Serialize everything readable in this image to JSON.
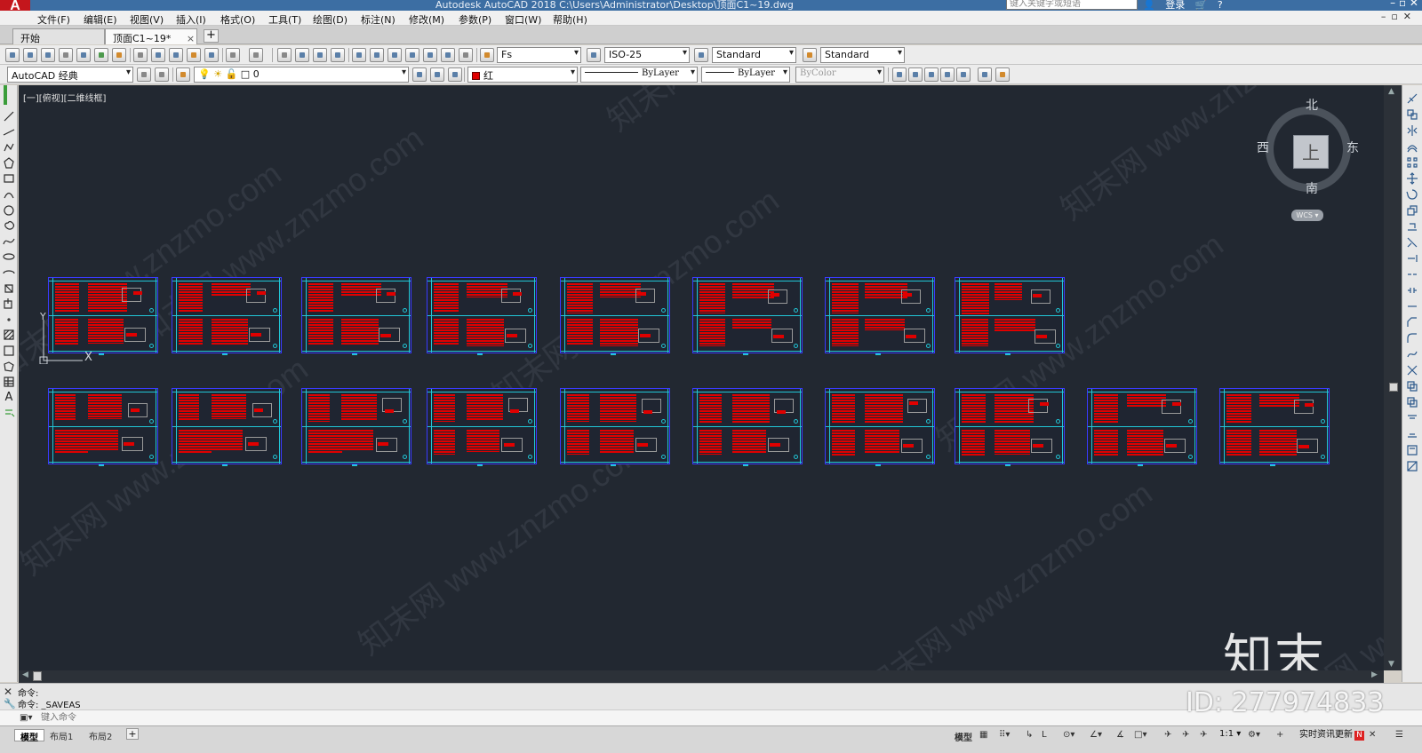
{
  "app": {
    "title": "Autodesk AutoCAD 2018     C:\\Users\\Administrator\\Desktop\\顶面C1~19.dwg",
    "search_placeholder": "键入关键字或短语",
    "login": "登录",
    "help": "?"
  },
  "menu": [
    "文件(F)",
    "编辑(E)",
    "视图(V)",
    "插入(I)",
    "格式(O)",
    "工具(T)",
    "绘图(D)",
    "标注(N)",
    "修改(M)",
    "参数(P)",
    "窗口(W)",
    "帮助(H)"
  ],
  "tabs": [
    {
      "label": "开始",
      "active": false
    },
    {
      "label": "顶面C1~19*",
      "active": true
    }
  ],
  "tab_close_glyph": "×",
  "toolbar1": {
    "text_style": "Fs",
    "dim_style": "ISO-25",
    "table_style": "Standard",
    "mleader_style": "Standard"
  },
  "toolbar2": {
    "workspace": "AutoCAD 经典",
    "layer": "0",
    "color": "红",
    "linetype": "ByLayer",
    "lineweight": "ByLayer",
    "plotstyle": "ByColor"
  },
  "viewport": {
    "label": "[一][俯视][二维线框]"
  },
  "viewcube": {
    "north": "北",
    "south": "南",
    "east": "东",
    "west": "西",
    "top": "上",
    "wcs": "WCS ▾"
  },
  "ucs": {
    "x": "X",
    "y": "Y"
  },
  "watermark_text": "知末网 www.znzmo.com",
  "brand": "知末",
  "id_label": "ID: 277974833",
  "command": {
    "history": [
      "命令:",
      "命令:  _SAVEAS"
    ],
    "placeholder": "键入命令"
  },
  "layouts": [
    {
      "label": "模型",
      "active": true
    },
    {
      "label": "布局1",
      "active": false
    },
    {
      "label": "布局2",
      "active": false
    }
  ],
  "status": {
    "model": "模型",
    "zoom": "1:1 ▾",
    "news": "实时资讯更新",
    "news_badge": "N"
  },
  "colors": {
    "canvas_bg": "#222831",
    "sheet_red": "#e00000",
    "sheet_cyan": "#21c6d6",
    "sheet_border": "#3a3aff",
    "titlebar": "#3c6ea3"
  },
  "sheets": {
    "rows": 2,
    "row1_count": 8,
    "row2_count": 10
  }
}
